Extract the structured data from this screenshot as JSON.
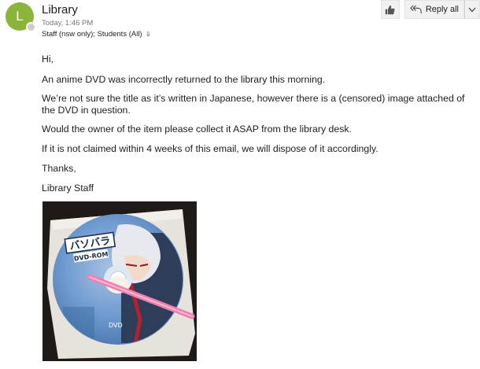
{
  "header": {
    "avatar_letter": "L",
    "sender": "Library",
    "time": "Today, 1:46 PM",
    "recipients": "Staff (nsw only); Students (All)",
    "reply_all_label": "Reply all"
  },
  "message": {
    "greeting": "Hi,",
    "p1": "An anime DVD was incorrectly returned to the library this morning.",
    "p2": "We’re not sure the title as it’s written in Japanese, however there is a (censored) image attached of the DVD in question.",
    "p3": "Would the owner of the item please collect it ASAP from the library desk.",
    "p4": "If it is not claimed within 4 weeks of this email, we will dispose of it accordingly.",
    "closing": "Thanks,",
    "signature": "Library Staff"
  },
  "attachment": {
    "disc_title": "バソバラ",
    "disc_format": "DVD-ROM",
    "disc_bottom_label": "DVD"
  },
  "icons": {
    "like": "thumbs-up-icon",
    "reply_all": "reply-all-icon",
    "more": "chevron-down-icon",
    "expand": "double-chevron-down-icon"
  },
  "colors": {
    "avatar": "#8bb53a",
    "disc_base": "#5f8fc4"
  }
}
